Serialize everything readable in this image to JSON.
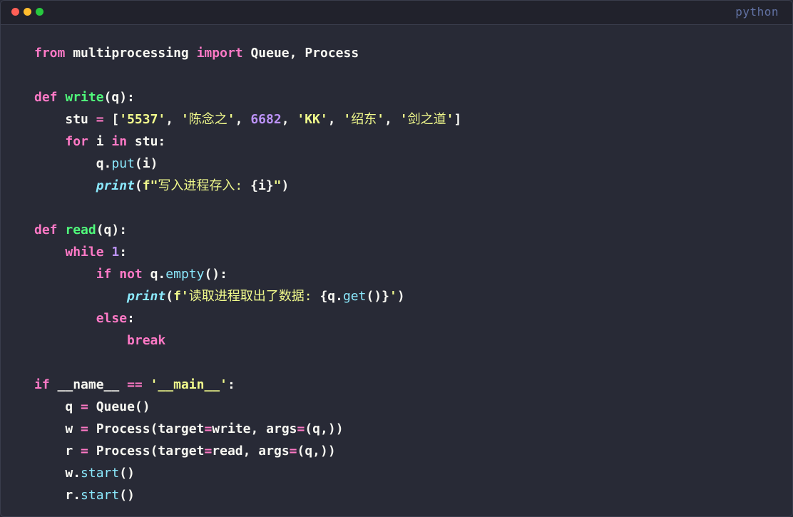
{
  "window": {
    "language": "python",
    "traffic_lights": {
      "close": "#ff5f56",
      "minimize": "#ffbd2e",
      "maximize": "#27c93f"
    }
  },
  "theme": {
    "background": "#282a36",
    "keyword": "#ff79c6",
    "function": "#50fa7b",
    "string": "#f1fa8c",
    "number": "#bd93f9",
    "builtin": "#8be9fd",
    "text": "#f8f8f2"
  },
  "code": {
    "l1": {
      "kw_from": "from",
      "mod": " multiprocessing ",
      "kw_import": "import",
      "names": " Queue, Process"
    },
    "l3": {
      "kw_def": "def",
      "sp": " ",
      "fn": "write",
      "args": "(q):"
    },
    "l4": {
      "indent": "    ",
      "var": "stu",
      "eq": " = ",
      "b1": "[",
      "s1": "'5537'",
      "c1": ", ",
      "s2a": "'",
      "s2b": "陈念之",
      "s2c": "'",
      "c2": ", ",
      "n1": "6682",
      "c3": ", ",
      "s3": "'KK'",
      "c4": ", ",
      "s4a": "'",
      "s4b": "绍东",
      "s4c": "'",
      "c5": ", ",
      "s5a": "'",
      "s5b": "剑之道",
      "s5c": "'",
      "b2": "]"
    },
    "l5": {
      "indent": "    ",
      "kw_for": "for",
      "mid": " i ",
      "kw_in": "in",
      "rest": " stu:"
    },
    "l6": {
      "indent": "        ",
      "obj": "q.",
      "method": "put",
      "rest": "(i)"
    },
    "l7": {
      "indent": "        ",
      "bi": "print",
      "p1": "(",
      "fa": "f\"",
      "fb": "写入进程存入: ",
      "fc": "{i}",
      "fd": "\"",
      "p2": ")"
    },
    "l9": {
      "kw_def": "def",
      "sp": " ",
      "fn": "read",
      "args": "(q):"
    },
    "l10": {
      "indent": "    ",
      "kw_while": "while",
      "sp": " ",
      "num": "1",
      "rest": ":"
    },
    "l11": {
      "indent": "        ",
      "kw_if": "if",
      "sp1": " ",
      "kw_not": "not",
      "mid": " q.",
      "method": "empty",
      "rest": "():"
    },
    "l12": {
      "indent": "            ",
      "bi": "print",
      "p1": "(",
      "fa": "f'",
      "fb": "读取进程取出了数据: ",
      "fc": "{q.",
      "method": "get",
      "fd": "()}",
      "fe": "'",
      "p2": ")"
    },
    "l13": {
      "indent": "        ",
      "kw_else": "else",
      "rest": ":"
    },
    "l14": {
      "indent": "            ",
      "kw_break": "break"
    },
    "l16": {
      "kw_if": "if",
      "mid": " __name__ ",
      "op": "==",
      "sp": " ",
      "str": "'__main__'",
      "rest": ":"
    },
    "l17": {
      "indent": "    ",
      "var": "q",
      "eq": " = ",
      "rest": "Queue()"
    },
    "l18": {
      "indent": "    ",
      "var": "w",
      "eq": " = ",
      "a": "Process(target",
      "eq2": "=",
      "b": "write, args",
      "eq3": "=",
      "c": "(q,))"
    },
    "l19": {
      "indent": "    ",
      "var": "r",
      "eq": " = ",
      "a": "Process(target",
      "eq2": "=",
      "b": "read, args",
      "eq3": "=",
      "c": "(q,))"
    },
    "l20": {
      "indent": "    ",
      "obj": "w.",
      "method": "start",
      "rest": "()"
    },
    "l21": {
      "indent": "    ",
      "obj": "r.",
      "method": "start",
      "rest": "()"
    }
  }
}
